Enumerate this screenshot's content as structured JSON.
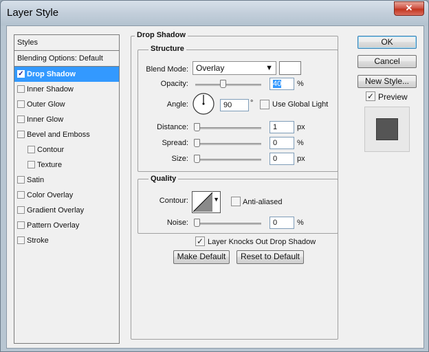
{
  "window": {
    "title": "Layer Style",
    "close_glyph": "✕"
  },
  "styles_panel": {
    "header": "Styles",
    "blending_options": "Blending Options: Default",
    "items": [
      {
        "label": "Drop Shadow",
        "checked": true,
        "selected": true,
        "indent": false
      },
      {
        "label": "Inner Shadow",
        "checked": false,
        "selected": false,
        "indent": false
      },
      {
        "label": "Outer Glow",
        "checked": false,
        "selected": false,
        "indent": false
      },
      {
        "label": "Inner Glow",
        "checked": false,
        "selected": false,
        "indent": false
      },
      {
        "label": "Bevel and Emboss",
        "checked": false,
        "selected": false,
        "indent": false
      },
      {
        "label": "Contour",
        "checked": false,
        "selected": false,
        "indent": true
      },
      {
        "label": "Texture",
        "checked": false,
        "selected": false,
        "indent": true
      },
      {
        "label": "Satin",
        "checked": false,
        "selected": false,
        "indent": false
      },
      {
        "label": "Color Overlay",
        "checked": false,
        "selected": false,
        "indent": false
      },
      {
        "label": "Gradient Overlay",
        "checked": false,
        "selected": false,
        "indent": false
      },
      {
        "label": "Pattern Overlay",
        "checked": false,
        "selected": false,
        "indent": false
      },
      {
        "label": "Stroke",
        "checked": false,
        "selected": false,
        "indent": false
      }
    ]
  },
  "drop_shadow": {
    "section_title": "Drop Shadow",
    "structure": {
      "title": "Structure",
      "blend_mode_label": "Blend Mode:",
      "blend_mode_value": "Overlay",
      "shadow_color": "#ffffff",
      "opacity_label": "Opacity:",
      "opacity_value": "40",
      "opacity_unit": "%",
      "angle_label": "Angle:",
      "angle_value": "90",
      "angle_unit": "°",
      "global_light_label": "Use Global Light",
      "global_light_checked": false,
      "distance_label": "Distance:",
      "distance_value": "1",
      "distance_unit": "px",
      "spread_label": "Spread:",
      "spread_value": "0",
      "spread_unit": "%",
      "size_label": "Size:",
      "size_value": "0",
      "size_unit": "px"
    },
    "quality": {
      "title": "Quality",
      "contour_label": "Contour:",
      "anti_aliased_label": "Anti-aliased",
      "anti_aliased_checked": false,
      "noise_label": "Noise:",
      "noise_value": "0",
      "noise_unit": "%"
    },
    "knockout_label": "Layer Knocks Out Drop Shadow",
    "knockout_checked": true,
    "make_default": "Make Default",
    "reset_default": "Reset to Default"
  },
  "actions": {
    "ok": "OK",
    "cancel": "Cancel",
    "new_style": "New Style...",
    "preview_label": "Preview",
    "preview_checked": true
  },
  "colors": {
    "selection": "#3399ff",
    "preview_swatch": "#555555"
  },
  "icons": {
    "check": "✓",
    "dropdown": "▾"
  }
}
